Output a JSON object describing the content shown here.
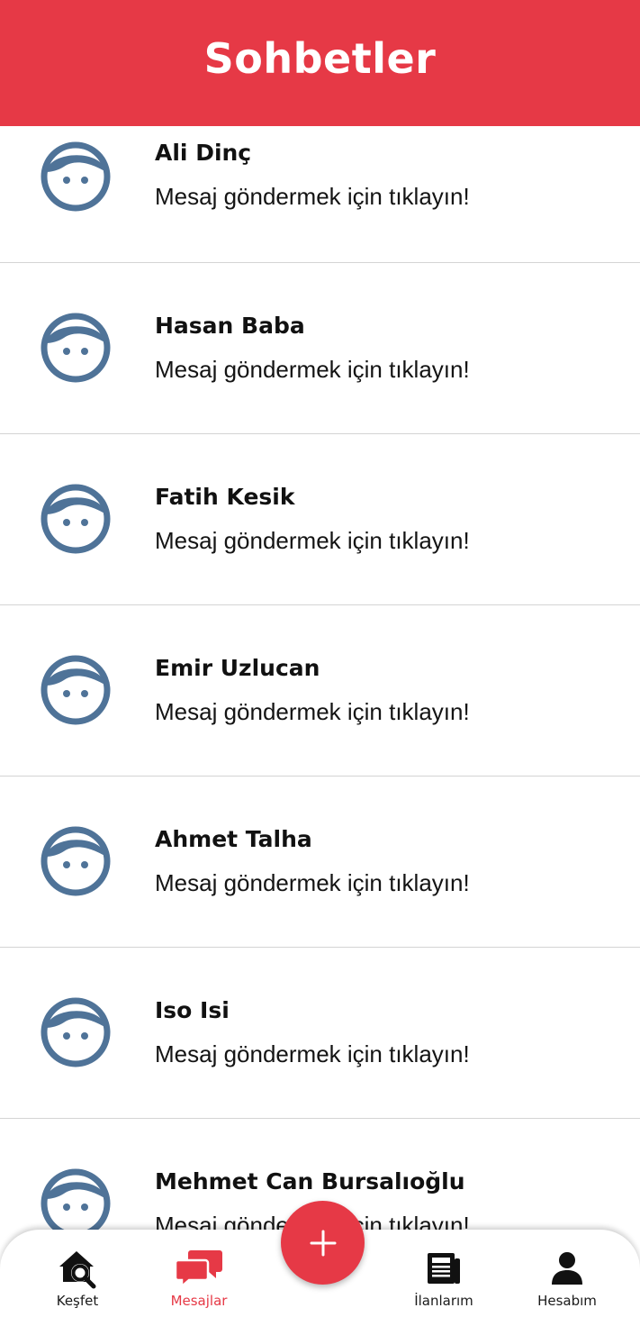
{
  "header": {
    "title": "Sohbetler"
  },
  "chats": [
    {
      "name": "Ali  Dinç",
      "message": "Mesaj göndermek için tıklayın!"
    },
    {
      "name": "Hasan Baba",
      "message": "Mesaj göndermek için tıklayın!"
    },
    {
      "name": "Fatih Kesik",
      "message": "Mesaj göndermek için tıklayın!"
    },
    {
      "name": "Emir Uzlucan",
      "message": "Mesaj göndermek için tıklayın!"
    },
    {
      "name": "Ahmet Talha",
      "message": "Mesaj göndermek için tıklayın!"
    },
    {
      "name": "Iso Isi",
      "message": "Mesaj göndermek için tıklayın!"
    },
    {
      "name": "Mehmet Can Bursalıoğlu",
      "message": "Mesaj göndermek için tıklayın!"
    }
  ],
  "nav": {
    "items": [
      {
        "label": "Keşfet",
        "icon": "home-search-icon"
      },
      {
        "label": "Mesajlar",
        "icon": "chat-bubbles-icon",
        "active": true
      },
      {
        "label": "İlanlarım",
        "icon": "newspaper-icon"
      },
      {
        "label": "Hesabım",
        "icon": "person-icon"
      }
    ],
    "fab_icon": "plus-icon"
  },
  "colors": {
    "accent": "#e63946",
    "avatar": "#4f7398",
    "text": "#111111"
  }
}
